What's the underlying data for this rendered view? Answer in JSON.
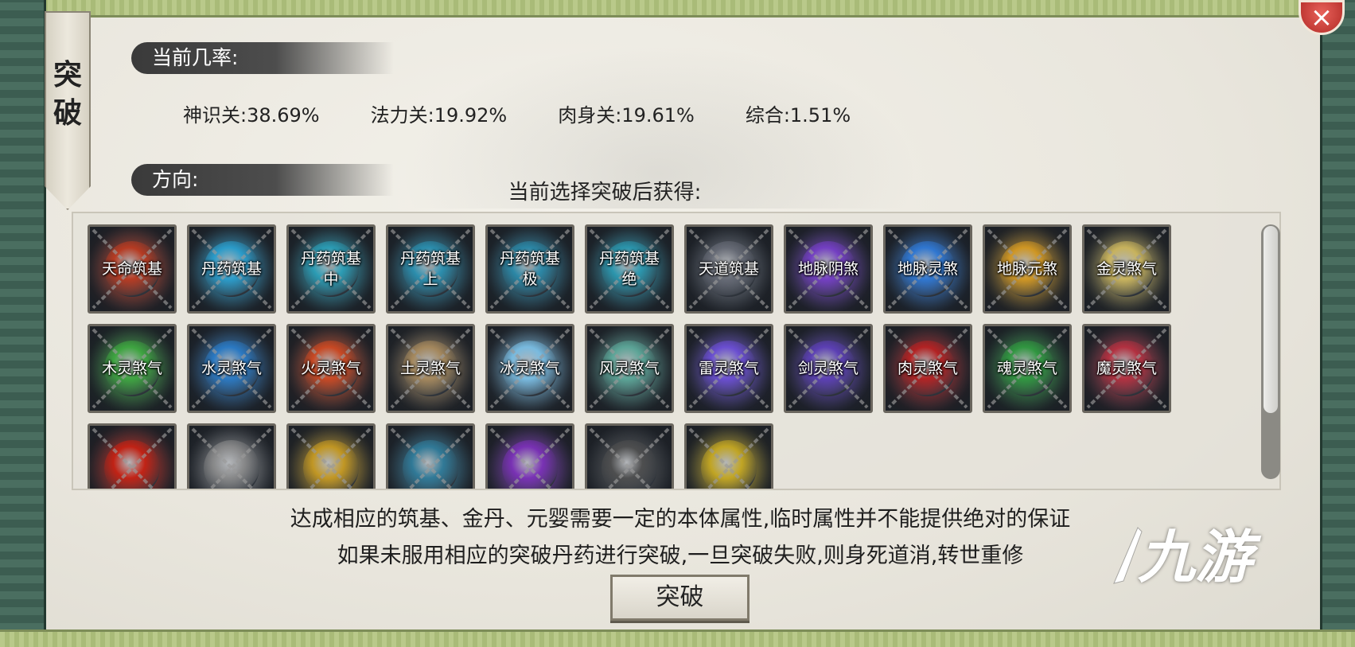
{
  "banner": {
    "title": "突\n破"
  },
  "close_icon": "×",
  "rates_section": {
    "heading": "当前几率:",
    "items": [
      {
        "label": "神识关:38.69%"
      },
      {
        "label": "法力关:19.92%"
      },
      {
        "label": "肉身关:19.61%"
      },
      {
        "label": "综合:1.51%"
      }
    ]
  },
  "direction_section": {
    "heading": "方向:"
  },
  "gain_title": "当前选择突破后获得:",
  "rows": [
    [
      {
        "label": "天命筑基",
        "color": "#c43b1f"
      },
      {
        "label": "丹药筑基",
        "color": "#2aa6d8"
      },
      {
        "label": "丹药筑基\n中",
        "color": "#2aa6c0"
      },
      {
        "label": "丹药筑基\n上",
        "color": "#2a96b8"
      },
      {
        "label": "丹药筑基\n极",
        "color": "#2a8fb0"
      },
      {
        "label": "丹药筑基\n绝",
        "color": "#2a9fb8"
      },
      {
        "label": "天道筑基",
        "color": "#6b6f7a"
      },
      {
        "label": "地脉阴煞",
        "color": "#7a3fd0"
      },
      {
        "label": "地脉灵煞",
        "color": "#2f7de0"
      },
      {
        "label": "地脉元煞",
        "color": "#e0a020"
      },
      {
        "label": "金灵煞气",
        "color": "#d8c060"
      }
    ],
    [
      {
        "label": "木灵煞气",
        "color": "#3fb040"
      },
      {
        "label": "水灵煞气",
        "color": "#2a80d0"
      },
      {
        "label": "火灵煞气",
        "color": "#d84a20"
      },
      {
        "label": "土灵煞气",
        "color": "#b09060"
      },
      {
        "label": "冰灵煞气",
        "color": "#80c8f0"
      },
      {
        "label": "风灵煞气",
        "color": "#60b0a0"
      },
      {
        "label": "雷灵煞气",
        "color": "#7050e0"
      },
      {
        "label": "剑灵煞气",
        "color": "#6040c0"
      },
      {
        "label": "肉灵煞气",
        "color": "#c02020"
      },
      {
        "label": "魂灵煞气",
        "color": "#30a040"
      },
      {
        "label": "魔灵煞气",
        "color": "#c03040"
      }
    ],
    [
      {
        "label": "",
        "color": "#d02010"
      },
      {
        "label": "",
        "color": "#909090"
      },
      {
        "label": "",
        "color": "#d0a020"
      },
      {
        "label": "",
        "color": "#3080a0"
      },
      {
        "label": "",
        "color": "#8030c0"
      },
      {
        "label": "",
        "color": "#505050"
      },
      {
        "label": "",
        "color": "#d0b020"
      }
    ]
  ],
  "notes": {
    "line1": "达成相应的筑基、金丹、元婴需要一定的本体属性,临时属性并不能提供绝对的保证",
    "line2": "如果未服用相应的突破丹药进行突破,一旦突破失败,则身死道消,转世重修"
  },
  "break_button": "突破",
  "watermark": "九游"
}
